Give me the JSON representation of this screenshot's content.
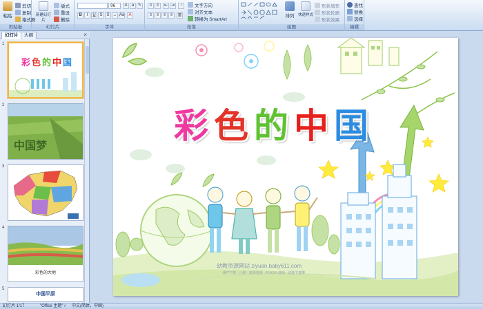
{
  "ribbon": {
    "clipboard": {
      "label": "剪贴板",
      "paste": "粘贴",
      "cut": "剪切",
      "copy": "复制",
      "format_painter": "格式刷"
    },
    "slides": {
      "label": "幻灯片",
      "new_slide": "新建幻灯片",
      "layout": "版式",
      "reset": "重设",
      "delete": "删除"
    },
    "font": {
      "label": "字体",
      "font_size": "96"
    },
    "paragraph": {
      "label": "段落",
      "text_direction": "文字方向",
      "align_text": "对齐文本",
      "smartart": "转换为 SmartArt"
    },
    "drawing": {
      "label": "绘图",
      "arrange": "排列",
      "quick_styles": "快速样式",
      "shape_fill": "形状填充",
      "shape_outline": "形状轮廓",
      "shape_effects": "形状效果"
    },
    "editing": {
      "label": "编辑",
      "find": "查找",
      "replace": "替换",
      "select": "选择"
    }
  },
  "panel": {
    "tabs": [
      "幻灯片",
      "大纲"
    ],
    "close": "×",
    "slides": [
      {
        "num": "1"
      },
      {
        "num": "2"
      },
      {
        "num": "3"
      },
      {
        "num": "4",
        "caption": "彩色的大地"
      },
      {
        "num": "5",
        "caption": "中国平原"
      }
    ]
  },
  "slide": {
    "title_chars": [
      "彩",
      "色",
      "的",
      "中",
      "国"
    ],
    "title_colors": [
      "#ee3aa0",
      "#e3342a",
      "#5fc232",
      "#e8201c",
      "#2c8ce0"
    ],
    "footer_text": "幼教资源网站  ziyuan.baby611.com",
    "footer_sub": "课件下载 · 儿歌 · 故事视频 · FLASH 游戏 · 试卷下载等"
  },
  "status": {
    "slide_info": "幻灯片 1/17",
    "theme": "\"Office 主题\"",
    "language": "中文(简体，中国)"
  },
  "colors": {
    "accent_selected": "#f3b44a",
    "ribbon_border": "#8ba7cc"
  }
}
